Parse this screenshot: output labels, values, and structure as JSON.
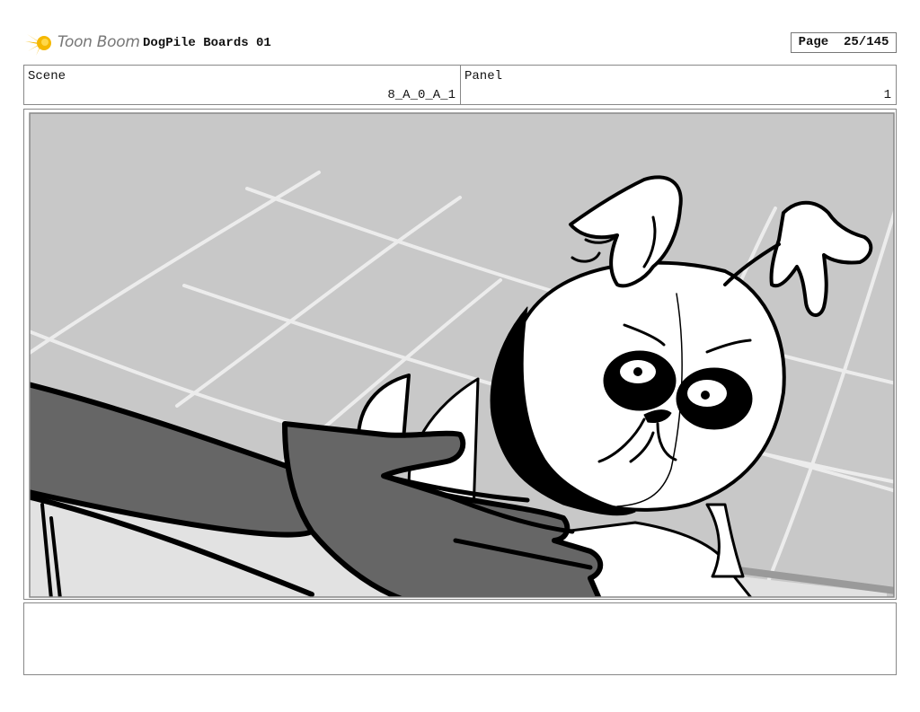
{
  "header": {
    "logo_text": "Toon Boom",
    "project_title": "DogPile Boards 01",
    "page_label": "Page",
    "page_value": "25/145"
  },
  "info": {
    "scene_label": "Scene",
    "scene_value": "8_A_0_A_1",
    "panel_label": "Panel",
    "panel_value": "1"
  },
  "notes": {
    "text": ""
  },
  "colors": {
    "logo_yellow": "#f5b800",
    "background_gray": "#c8c8c8",
    "hand_gray": "#666666",
    "line_black": "#000000"
  }
}
